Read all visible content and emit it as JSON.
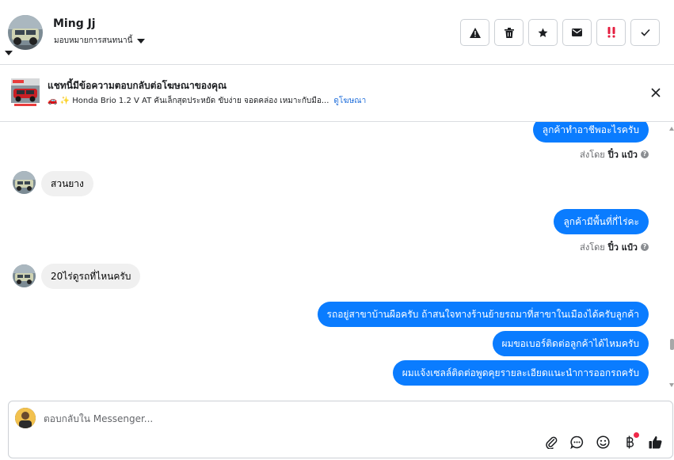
{
  "header": {
    "contact_name": "Ming Jj",
    "assign_label": "มอบหมายการสนทนานี้",
    "actions": [
      {
        "icon": "warning-icon"
      },
      {
        "icon": "trash-icon"
      },
      {
        "icon": "star-icon"
      },
      {
        "icon": "mail-icon"
      },
      {
        "icon": "double-exclamation-icon"
      },
      {
        "icon": "checkmark-icon"
      }
    ]
  },
  "ad_banner": {
    "title": "แชทนี้มีข้อความตอบกลับต่อโฆษณาของคุณ",
    "subtitle": "🚗 ✨ Honda Brio 1.2 V AT คันเล็กสุดประหยัด ขับง่าย จอดคล่อง เหมาะกับมือ...",
    "link_label": "ดูโฆษณา"
  },
  "messages": [
    {
      "direction": "out",
      "text": "ลูกค้าทำอาชีพอะไรครับ"
    },
    {
      "direction": "sent_by",
      "prefix": "ส่งโดย",
      "name": "ปิ๋ว แป๋ว"
    },
    {
      "direction": "in",
      "text": "สวนยาง"
    },
    {
      "direction": "out",
      "text": "ลูกค้ามีพื้นที่กี่ไร่คะ"
    },
    {
      "direction": "sent_by",
      "prefix": "ส่งโดย",
      "name": "ปิ๋ว แป๋ว"
    },
    {
      "direction": "in",
      "text": "20ไร่ดูรถที่ไหนครับ"
    },
    {
      "direction": "out",
      "text": "รถอยู่สาขาบ้านผือครับ ถ้าสนใจทางร้านย้ายรถมาที่สาขาในเมืองได้ครับลูกค้า"
    },
    {
      "direction": "out",
      "text": "ผมขอเบอร์ติดต่อลูกค้าได้ไหมครับ"
    },
    {
      "direction": "out",
      "text": "ผมแจ้งเซลล์ติดต่อพูดคุยรายละเอียดแนะนำการออกรถครับ"
    }
  ],
  "composer": {
    "placeholder": "ตอบกลับใน Messenger...",
    "tools": [
      "paperclip-icon",
      "chat-bubble-icon",
      "emoji-icon",
      "baht-icon",
      "thumbs-up-icon"
    ]
  },
  "colors": {
    "outgoing_bubble": "#0a7cff",
    "incoming_bubble": "#f0f0f0",
    "link": "#216fdb",
    "notification_dot": "#f02849"
  }
}
